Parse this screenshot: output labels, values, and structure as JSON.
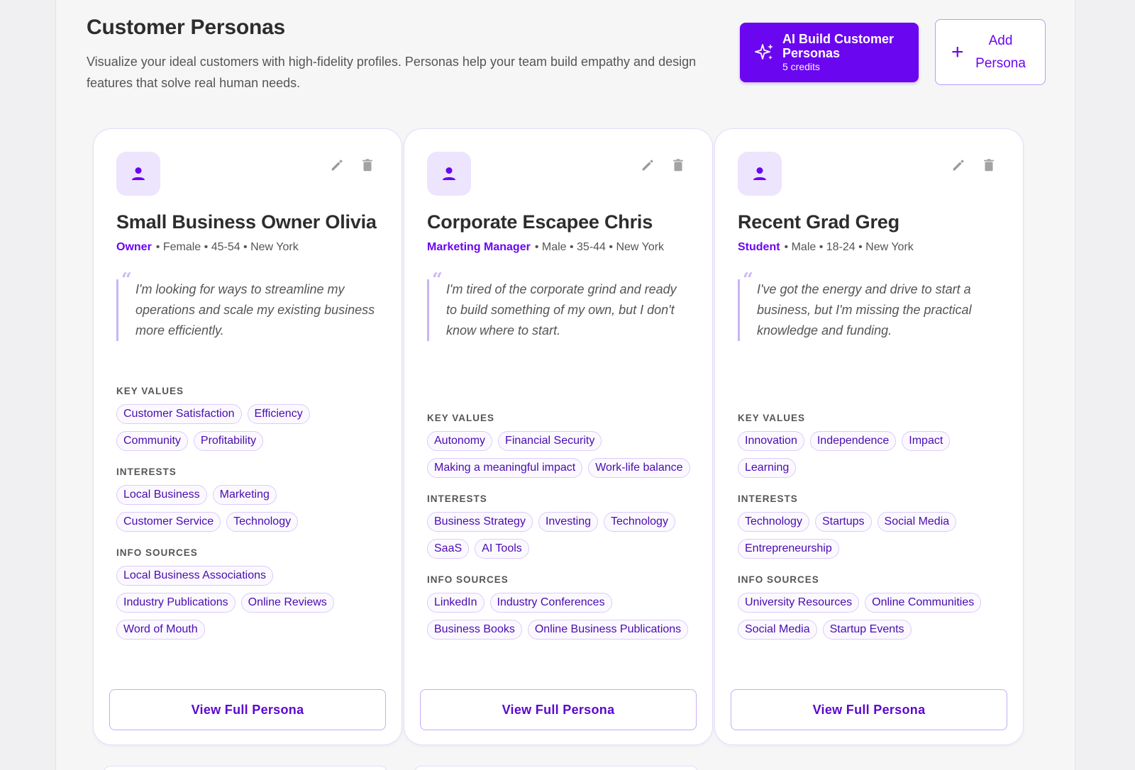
{
  "header": {
    "title": "Customer Personas",
    "description": "Visualize your ideal customers with high-fidelity profiles. Personas help your team build empathy and design features that solve real human needs.",
    "ai_button": {
      "label": "AI Build Customer Personas",
      "credits": "5 credits",
      "icon": "sparkle-icon"
    },
    "add_button": {
      "label": "Add Persona",
      "icon": "plus-icon"
    }
  },
  "labels": {
    "key_values": "KEY VALUES",
    "interests": "INTERESTS",
    "info_sources": "INFO SOURCES",
    "view_full": "View Full Persona"
  },
  "colors": {
    "accent": "#6b06f0",
    "tag_text": "#4a0bb0",
    "avatar_bg": "#ede4fd"
  },
  "personas": [
    {
      "name": "Small Business Owner Olivia",
      "role": "Owner",
      "demographics": "• Female • 45-54 • New York",
      "quote": "I'm looking for ways to streamline my operations and scale my existing business more efficiently.",
      "key_values": [
        "Customer Satisfaction",
        "Efficiency",
        "Community",
        "Profitability"
      ],
      "interests": [
        "Local Business",
        "Marketing",
        "Customer Service",
        "Technology"
      ],
      "info_sources": [
        "Local Business Associations",
        "Industry Publications",
        "Online Reviews",
        "Word of Mouth"
      ]
    },
    {
      "name": "Corporate Escapee Chris",
      "role": "Marketing Manager",
      "demographics": "• Male • 35-44 • New York",
      "quote": "I'm tired of the corporate grind and ready to build something of my own, but I don't know where to start.",
      "key_values": [
        "Autonomy",
        "Financial Security",
        "Making a meaningful impact",
        "Work-life balance"
      ],
      "interests": [
        "Business Strategy",
        "Investing",
        "Technology",
        "SaaS",
        "AI Tools"
      ],
      "info_sources": [
        "LinkedIn",
        "Industry Conferences",
        "Business Books",
        "Online Business Publications"
      ]
    },
    {
      "name": "Recent Grad Greg",
      "role": "Student",
      "demographics": "• Male • 18-24 • New York",
      "quote": "I've got the energy and drive to start a business, but I'm missing the practical knowledge and funding.",
      "key_values": [
        "Innovation",
        "Independence",
        "Impact",
        "Learning"
      ],
      "interests": [
        "Technology",
        "Startups",
        "Social Media",
        "Entrepreneurship"
      ],
      "info_sources": [
        "University Resources",
        "Online Communities",
        "Social Media",
        "Startup Events"
      ]
    }
  ]
}
